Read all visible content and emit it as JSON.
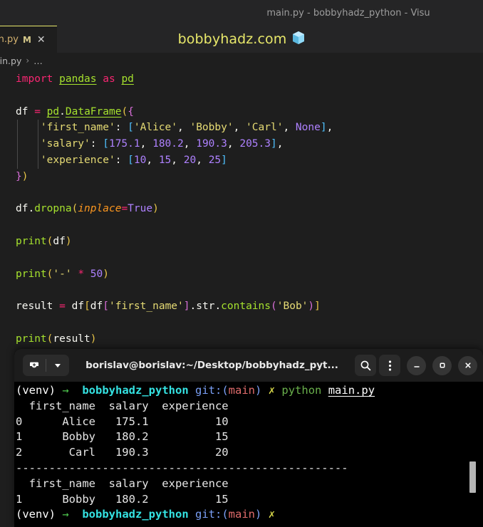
{
  "window": {
    "title": "main.py - bobbyhadz_python - Visu"
  },
  "banner": {
    "text": "bobbyhadz.com",
    "icon": "ice-cube-emoji",
    "text_color": "#e8e86a"
  },
  "tab": {
    "label": "in.py",
    "dirty_marker": "M",
    "close_glyph": "✕"
  },
  "breadcrumb": {
    "file": "ain.py",
    "separator": "›",
    "dots": "…"
  },
  "editor": {
    "lines": [
      {
        "id": "line-import",
        "tokens": [
          {
            "t": "import",
            "c": "t-kw"
          },
          {
            "t": " ",
            "c": "t-plain"
          },
          {
            "t": "pandas",
            "c": "t-mod"
          },
          {
            "t": " ",
            "c": "t-plain"
          },
          {
            "t": "as",
            "c": "t-kw"
          },
          {
            "t": " ",
            "c": "t-plain"
          },
          {
            "t": "pd",
            "c": "t-mod"
          }
        ]
      },
      {
        "id": "line-blank-1",
        "tokens": []
      },
      {
        "id": "line-df-assign",
        "tokens": [
          {
            "t": "df",
            "c": "t-var"
          },
          {
            "t": " ",
            "c": "t-plain"
          },
          {
            "t": "=",
            "c": "t-kw"
          },
          {
            "t": " ",
            "c": "t-plain"
          },
          {
            "t": "pd",
            "c": "t-mod"
          },
          {
            "t": ".",
            "c": "t-punct"
          },
          {
            "t": "DataFrame",
            "c": "t-class"
          },
          {
            "t": "(",
            "c": "t-paren-y"
          },
          {
            "t": "{",
            "c": "t-paren-m"
          }
        ]
      },
      {
        "id": "line-first-name",
        "indent": 1,
        "tokens": [
          {
            "t": "    ",
            "c": "t-plain"
          },
          {
            "t": "'first_name'",
            "c": "t-str"
          },
          {
            "t": ":",
            "c": "t-punct"
          },
          {
            "t": " ",
            "c": "t-plain"
          },
          {
            "t": "[",
            "c": "t-bracket-b"
          },
          {
            "t": "'Alice'",
            "c": "t-str"
          },
          {
            "t": ", ",
            "c": "t-punct"
          },
          {
            "t": "'Bobby'",
            "c": "t-str"
          },
          {
            "t": ", ",
            "c": "t-punct"
          },
          {
            "t": "'Carl'",
            "c": "t-str"
          },
          {
            "t": ", ",
            "c": "t-punct"
          },
          {
            "t": "None",
            "c": "t-const"
          },
          {
            "t": "]",
            "c": "t-bracket-b"
          },
          {
            "t": ",",
            "c": "t-punct"
          }
        ]
      },
      {
        "id": "line-salary",
        "indent": 1,
        "tokens": [
          {
            "t": "    ",
            "c": "t-plain"
          },
          {
            "t": "'salary'",
            "c": "t-str"
          },
          {
            "t": ":",
            "c": "t-punct"
          },
          {
            "t": " ",
            "c": "t-plain"
          },
          {
            "t": "[",
            "c": "t-bracket-b"
          },
          {
            "t": "175.1",
            "c": "t-num"
          },
          {
            "t": ", ",
            "c": "t-punct"
          },
          {
            "t": "180.2",
            "c": "t-num"
          },
          {
            "t": ", ",
            "c": "t-punct"
          },
          {
            "t": "190.3",
            "c": "t-num"
          },
          {
            "t": ", ",
            "c": "t-punct"
          },
          {
            "t": "205.3",
            "c": "t-num"
          },
          {
            "t": "]",
            "c": "t-bracket-b"
          },
          {
            "t": ",",
            "c": "t-punct"
          }
        ]
      },
      {
        "id": "line-experience",
        "indent": 1,
        "tokens": [
          {
            "t": "    ",
            "c": "t-plain"
          },
          {
            "t": "'experience'",
            "c": "t-str"
          },
          {
            "t": ":",
            "c": "t-punct"
          },
          {
            "t": " ",
            "c": "t-plain"
          },
          {
            "t": "[",
            "c": "t-bracket-b"
          },
          {
            "t": "10",
            "c": "t-num"
          },
          {
            "t": ", ",
            "c": "t-punct"
          },
          {
            "t": "15",
            "c": "t-num"
          },
          {
            "t": ", ",
            "c": "t-punct"
          },
          {
            "t": "20",
            "c": "t-num"
          },
          {
            "t": ", ",
            "c": "t-punct"
          },
          {
            "t": "25",
            "c": "t-num"
          },
          {
            "t": "]",
            "c": "t-bracket-b"
          }
        ]
      },
      {
        "id": "line-df-close",
        "tokens": [
          {
            "t": "}",
            "c": "t-paren-m"
          },
          {
            "t": ")",
            "c": "t-paren-y"
          }
        ]
      },
      {
        "id": "line-blank-2",
        "tokens": []
      },
      {
        "id": "line-dropna",
        "tokens": [
          {
            "t": "df",
            "c": "t-var"
          },
          {
            "t": ".",
            "c": "t-punct"
          },
          {
            "t": "dropna",
            "c": "t-func"
          },
          {
            "t": "(",
            "c": "t-paren-y"
          },
          {
            "t": "inplace",
            "c": "t-param"
          },
          {
            "t": "=",
            "c": "t-op"
          },
          {
            "t": "True",
            "c": "t-const"
          },
          {
            "t": ")",
            "c": "t-paren-y"
          }
        ]
      },
      {
        "id": "line-blank-3",
        "tokens": []
      },
      {
        "id": "line-print-df",
        "tokens": [
          {
            "t": "print",
            "c": "t-func"
          },
          {
            "t": "(",
            "c": "t-paren-y"
          },
          {
            "t": "df",
            "c": "t-var"
          },
          {
            "t": ")",
            "c": "t-paren-y"
          }
        ]
      },
      {
        "id": "line-blank-4",
        "tokens": []
      },
      {
        "id": "line-print-sep",
        "tokens": [
          {
            "t": "print",
            "c": "t-func"
          },
          {
            "t": "(",
            "c": "t-paren-y"
          },
          {
            "t": "'-'",
            "c": "t-str"
          },
          {
            "t": " ",
            "c": "t-plain"
          },
          {
            "t": "*",
            "c": "t-op"
          },
          {
            "t": " ",
            "c": "t-plain"
          },
          {
            "t": "50",
            "c": "t-num"
          },
          {
            "t": ")",
            "c": "t-paren-y"
          }
        ]
      },
      {
        "id": "line-blank-5",
        "tokens": []
      },
      {
        "id": "line-result",
        "tokens": [
          {
            "t": "result",
            "c": "t-var"
          },
          {
            "t": " ",
            "c": "t-plain"
          },
          {
            "t": "=",
            "c": "t-kw"
          },
          {
            "t": " ",
            "c": "t-plain"
          },
          {
            "t": "df",
            "c": "t-var"
          },
          {
            "t": "[",
            "c": "t-bracket-y"
          },
          {
            "t": "df",
            "c": "t-var"
          },
          {
            "t": "[",
            "c": "t-bracket-m"
          },
          {
            "t": "'first_name'",
            "c": "t-str"
          },
          {
            "t": "]",
            "c": "t-bracket-m"
          },
          {
            "t": ".",
            "c": "t-punct"
          },
          {
            "t": "str",
            "c": "t-var"
          },
          {
            "t": ".",
            "c": "t-punct"
          },
          {
            "t": "contains",
            "c": "t-func"
          },
          {
            "t": "(",
            "c": "t-paren-m"
          },
          {
            "t": "'Bob'",
            "c": "t-str"
          },
          {
            "t": ")",
            "c": "t-paren-m"
          },
          {
            "t": "]",
            "c": "t-bracket-y"
          }
        ]
      },
      {
        "id": "line-blank-6",
        "tokens": []
      },
      {
        "id": "line-print-result",
        "tokens": [
          {
            "t": "print",
            "c": "t-func"
          },
          {
            "t": "(",
            "c": "t-paren-y"
          },
          {
            "t": "result",
            "c": "t-var"
          },
          {
            "t": ")",
            "c": "t-paren-y"
          }
        ]
      }
    ]
  },
  "terminal": {
    "header": {
      "title": "borislav@borislav:~/Desktop/bobbyhadz_pyt...",
      "new_terminal_icon": "terminal-add-icon",
      "dropdown_icon": "chevron-down-icon",
      "search_icon": "search-icon",
      "menu_icon": "kebab-menu-icon",
      "minimize_icon": "minimize-icon",
      "maximize_icon": "maximize-icon",
      "close_icon": "close-icon"
    },
    "lines": [
      {
        "id": "term-prompt-1",
        "segs": [
          {
            "t": "(venv) ",
            "c": "c-white"
          },
          {
            "t": "→",
            "c": "c-green"
          },
          {
            "t": "  ",
            "c": "c-out"
          },
          {
            "t": "bobbyhadz_python",
            "c": "c-cyan"
          },
          {
            "t": " ",
            "c": "c-out"
          },
          {
            "t": "git:",
            "c": "c-blue"
          },
          {
            "t": "(",
            "c": "c-blue"
          },
          {
            "t": "main",
            "c": "c-red"
          },
          {
            "t": ")",
            "c": "c-blue"
          },
          {
            "t": " ",
            "c": "c-out"
          },
          {
            "t": "✗",
            "c": "c-yellow"
          },
          {
            "t": " ",
            "c": "c-out"
          },
          {
            "t": "python",
            "c": "c-pygreen"
          },
          {
            "t": " ",
            "c": "c-out"
          },
          {
            "t": "main.py",
            "c": "c-underline"
          }
        ]
      },
      {
        "id": "term-header-1",
        "segs": [
          {
            "t": "  first_name  salary  experience",
            "c": "c-out"
          }
        ]
      },
      {
        "id": "term-row-0",
        "segs": [
          {
            "t": "0      Alice   175.1          10",
            "c": "c-out"
          }
        ]
      },
      {
        "id": "term-row-1",
        "segs": [
          {
            "t": "1      Bobby   180.2          15",
            "c": "c-out"
          }
        ]
      },
      {
        "id": "term-row-2",
        "segs": [
          {
            "t": "2       Carl   190.3          20",
            "c": "c-out"
          }
        ]
      },
      {
        "id": "term-separator",
        "segs": [
          {
            "t": "--------------------------------------------------",
            "c": "c-out"
          }
        ]
      },
      {
        "id": "term-header-2",
        "segs": [
          {
            "t": "  first_name  salary  experience",
            "c": "c-out"
          }
        ]
      },
      {
        "id": "term-row-3",
        "segs": [
          {
            "t": "1      Bobby   180.2          15",
            "c": "c-out"
          }
        ]
      },
      {
        "id": "term-prompt-2",
        "segs": [
          {
            "t": "(venv) ",
            "c": "c-white"
          },
          {
            "t": "→",
            "c": "c-green"
          },
          {
            "t": "  ",
            "c": "c-out"
          },
          {
            "t": "bobbyhadz_python",
            "c": "c-cyan"
          },
          {
            "t": " ",
            "c": "c-out"
          },
          {
            "t": "git:",
            "c": "c-blue"
          },
          {
            "t": "(",
            "c": "c-blue"
          },
          {
            "t": "main",
            "c": "c-red"
          },
          {
            "t": ")",
            "c": "c-blue"
          },
          {
            "t": " ",
            "c": "c-out"
          },
          {
            "t": "✗",
            "c": "c-yellow"
          }
        ]
      }
    ]
  }
}
